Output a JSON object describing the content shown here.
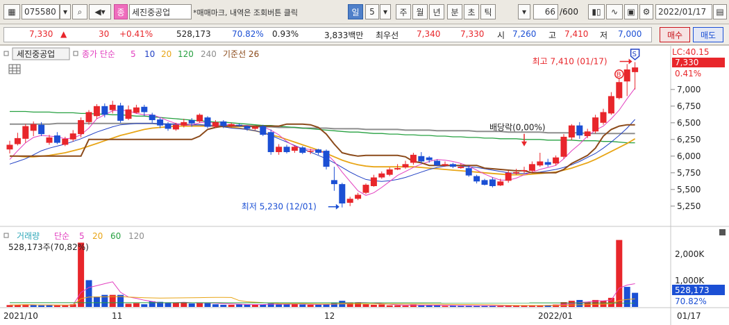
{
  "toolbar": {
    "code": "075580",
    "badge": "종",
    "stock_name": "세진중공업",
    "note": "*매매마크, 내역은 조회버튼 클릭",
    "periods": [
      "일",
      "5",
      "주",
      "월",
      "년",
      "분",
      "초",
      "틱"
    ],
    "count": "66",
    "count_total": "/600",
    "date": "2022/01/17"
  },
  "quote": {
    "price": "7,330",
    "change_arrow": "▲",
    "change": "30",
    "change_pct": "+0.41%",
    "volume": "528,173",
    "vol_ratio": "70.82%",
    "turnover": "0.93%",
    "trade_value": "3,833백만",
    "best_label": "최우선",
    "best_ask": "7,340",
    "best_bid": "7,330",
    "open_label": "시",
    "open": "7,260",
    "high_label": "고",
    "high": "7,410",
    "low_label": "저",
    "low": "7,000",
    "buy_label": "매수",
    "sell_label": "매도"
  },
  "legend": {
    "name": "세진중공업",
    "close_label": "종가 단순",
    "ma": [
      "5",
      "10",
      "20",
      "120",
      "240"
    ],
    "base_label": "기준선 26"
  },
  "volume_legend": {
    "label": "거래량",
    "ma_label": "단순",
    "ma": [
      "5",
      "20",
      "60",
      "120"
    ],
    "value_text": "528,173주(70,82%)"
  },
  "annotations": {
    "high_label": "최고 7,410 (01/17)",
    "low_label": "최저 5,230 (12/01)",
    "dividend_label": "배당락(0,00%)",
    "b_marker": "B",
    "s_marker": "S"
  },
  "right_axis": {
    "lc": "LC:40.15",
    "price_tag": "7,330",
    "pct_tag": "0.41%",
    "vol_tag": "528,173",
    "vol_pct_tag": "70.82%",
    "vol_ticks": [
      "2,000K",
      "1,000K"
    ]
  },
  "colors": {
    "up": "#e8262b",
    "down": "#1b4fd4",
    "ma5": "#e23fbf",
    "ma10": "#2140c4",
    "ma20": "#e8a516",
    "ma120": "#26a040",
    "ma240": "#8d8d8d",
    "base": "#8b4a1a"
  },
  "chart_data": {
    "type": "candlestick",
    "x_labels": [
      "2021/10",
      "11",
      "12",
      "2022/01",
      "01/17"
    ],
    "y_ticks": [
      7000,
      6750,
      6500,
      6250,
      6000,
      5750,
      5500,
      5250
    ],
    "ylim": [
      5050,
      7550
    ],
    "volume_ylim": [
      0,
      2800000
    ],
    "candles": [
      [
        6170,
        6100,
        6230,
        6040
      ],
      [
        6270,
        6180,
        6350,
        6160
      ],
      [
        6450,
        6260,
        6480,
        6200
      ],
      [
        6480,
        6380,
        6520,
        6300
      ],
      [
        6330,
        6470,
        6510,
        6300
      ],
      [
        6280,
        6200,
        6320,
        6170
      ],
      [
        6200,
        6310,
        6360,
        6180
      ],
      [
        6260,
        6170,
        6290,
        6150
      ],
      [
        6340,
        6250,
        6390,
        6220
      ],
      [
        6540,
        6330,
        6580,
        6280
      ],
      [
        6660,
        6510,
        6690,
        6470
      ],
      [
        6750,
        6600,
        6780,
        6560
      ],
      [
        6620,
        6750,
        6790,
        6580
      ],
      [
        6770,
        6690,
        6830,
        6640
      ],
      [
        6530,
        6760,
        6800,
        6500
      ],
      [
        6700,
        6560,
        6760,
        6540
      ],
      [
        6730,
        6650,
        6770,
        6640
      ],
      [
        6660,
        6740,
        6770,
        6600
      ],
      [
        6540,
        6620,
        6650,
        6500
      ],
      [
        6460,
        6550,
        6580,
        6420
      ],
      [
        6410,
        6490,
        6510,
        6380
      ],
      [
        6470,
        6400,
        6500,
        6380
      ],
      [
        6510,
        6460,
        6560,
        6430
      ],
      [
        6490,
        6540,
        6570,
        6440
      ],
      [
        6620,
        6520,
        6640,
        6500
      ],
      [
        6440,
        6580,
        6600,
        6420
      ],
      [
        6510,
        6440,
        6540,
        6420
      ],
      [
        6450,
        6520,
        6540,
        6420
      ],
      [
        6480,
        6450,
        6500,
        6430
      ],
      [
        6460,
        6470,
        6490,
        6440
      ],
      [
        6410,
        6450,
        6460,
        6380
      ],
      [
        6440,
        6410,
        6460,
        6390
      ],
      [
        6320,
        6450,
        6470,
        6300
      ],
      [
        6060,
        6360,
        6400,
        6020
      ],
      [
        6140,
        6060,
        6180,
        6020
      ],
      [
        6060,
        6140,
        6170,
        6040
      ],
      [
        6140,
        6080,
        6160,
        6050
      ],
      [
        6050,
        6130,
        6150,
        6030
      ],
      [
        6080,
        6080,
        6110,
        6030
      ],
      [
        6050,
        6100,
        6110,
        6020
      ],
      [
        5840,
        6080,
        6100,
        5800
      ],
      [
        5580,
        5640,
        5840,
        5480
      ],
      [
        5290,
        5580,
        5600,
        5230
      ],
      [
        5360,
        5300,
        5390,
        5250
      ],
      [
        5420,
        5360,
        5450,
        5340
      ],
      [
        5570,
        5450,
        5590,
        5430
      ],
      [
        5680,
        5550,
        5720,
        5540
      ],
      [
        5740,
        5680,
        5770,
        5660
      ],
      [
        5800,
        5720,
        5830,
        5700
      ],
      [
        5820,
        5800,
        5880,
        5790
      ],
      [
        5880,
        5830,
        5930,
        5810
      ],
      [
        6020,
        5900,
        6050,
        5870
      ],
      [
        5920,
        6000,
        6060,
        5890
      ],
      [
        5940,
        5980,
        6000,
        5900
      ],
      [
        5860,
        5930,
        5950,
        5850
      ],
      [
        5880,
        5860,
        5920,
        5840
      ],
      [
        5840,
        5880,
        5900,
        5820
      ],
      [
        5840,
        5820,
        5890,
        5810
      ],
      [
        5710,
        5820,
        5860,
        5690
      ],
      [
        5620,
        5700,
        5720,
        5590
      ],
      [
        5570,
        5640,
        5660,
        5560
      ],
      [
        5550,
        5650,
        5680,
        5530
      ],
      [
        5620,
        5560,
        5660,
        5550
      ],
      [
        5750,
        5630,
        5780,
        5600
      ],
      [
        5760,
        5740,
        5810,
        5720
      ],
      [
        5790,
        5780,
        5840,
        5740
      ],
      [
        5880,
        5780,
        5920,
        5760
      ],
      [
        5920,
        5860,
        6050,
        5840
      ],
      [
        5870,
        5910,
        5960,
        5840
      ],
      [
        5980,
        5890,
        6010,
        5860
      ],
      [
        6290,
        5990,
        6330,
        5960
      ],
      [
        6460,
        6280,
        6480,
        6240
      ],
      [
        6310,
        6460,
        6510,
        6260
      ],
      [
        6370,
        6300,
        6410,
        6270
      ],
      [
        6580,
        6370,
        6620,
        6340
      ],
      [
        6660,
        6500,
        6710,
        6470
      ],
      [
        6900,
        6640,
        6960,
        6620
      ],
      [
        7110,
        6870,
        7210,
        6850
      ],
      [
        7300,
        7120,
        7380,
        6900
      ],
      [
        7330,
        7260,
        7410,
        7000
      ]
    ],
    "volume": [
      [
        70000,
        1
      ],
      [
        85000,
        1
      ],
      [
        95000,
        1
      ],
      [
        70000,
        0
      ],
      [
        60000,
        0
      ],
      [
        70000,
        0
      ],
      [
        60000,
        1
      ],
      [
        75000,
        1
      ],
      [
        100000,
        1
      ],
      [
        2400000,
        1
      ],
      [
        1000000,
        0
      ],
      [
        390000,
        0
      ],
      [
        450000,
        0
      ],
      [
        450000,
        1
      ],
      [
        450000,
        0
      ],
      [
        120000,
        1
      ],
      [
        140000,
        1
      ],
      [
        100000,
        0
      ],
      [
        210000,
        0
      ],
      [
        190000,
        0
      ],
      [
        150000,
        0
      ],
      [
        160000,
        1
      ],
      [
        160000,
        1
      ],
      [
        130000,
        0
      ],
      [
        150000,
        1
      ],
      [
        160000,
        0
      ],
      [
        100000,
        0
      ],
      [
        80000,
        0
      ],
      [
        80000,
        1
      ],
      [
        100000,
        0
      ],
      [
        100000,
        0
      ],
      [
        80000,
        1
      ],
      [
        90000,
        0
      ],
      [
        130000,
        0
      ],
      [
        100000,
        0
      ],
      [
        100000,
        0
      ],
      [
        120000,
        1
      ],
      [
        90000,
        0
      ],
      [
        80000,
        1
      ],
      [
        80000,
        0
      ],
      [
        110000,
        0
      ],
      [
        150000,
        0
      ],
      [
        230000,
        0
      ],
      [
        170000,
        1
      ],
      [
        170000,
        1
      ],
      [
        100000,
        1
      ],
      [
        80000,
        1
      ],
      [
        90000,
        1
      ],
      [
        60000,
        1
      ],
      [
        60000,
        1
      ],
      [
        50000,
        1
      ],
      [
        90000,
        1
      ],
      [
        60000,
        0
      ],
      [
        60000,
        0
      ],
      [
        60000,
        0
      ],
      [
        40000,
        1
      ],
      [
        50000,
        0
      ],
      [
        40000,
        0
      ],
      [
        50000,
        0
      ],
      [
        40000,
        0
      ],
      [
        50000,
        0
      ],
      [
        50000,
        0
      ],
      [
        45000,
        1
      ],
      [
        60000,
        1
      ],
      [
        50000,
        1
      ],
      [
        50000,
        1
      ],
      [
        60000,
        1
      ],
      [
        50000,
        1
      ],
      [
        70000,
        0
      ],
      [
        90000,
        1
      ],
      [
        180000,
        1
      ],
      [
        230000,
        1
      ],
      [
        260000,
        0
      ],
      [
        180000,
        1
      ],
      [
        260000,
        1
      ],
      [
        230000,
        1
      ],
      [
        340000,
        1
      ],
      [
        2500000,
        1
      ],
      [
        750000,
        0
      ],
      [
        528173,
        0
      ]
    ],
    "ma": {
      "ma5": [
        5950,
        6080,
        6200,
        6280,
        6310,
        6300,
        6290,
        6260,
        6270,
        6320,
        6420,
        6560,
        6620,
        6680,
        6690,
        6680,
        6640,
        6620,
        6620,
        6580,
        6530,
        6490,
        6460,
        6470,
        6500,
        6510,
        6490,
        6480,
        6470,
        6460,
        6460,
        6450,
        6440,
        6390,
        6320,
        6220,
        6150,
        6110,
        6100,
        6080,
        6040,
        5920,
        5760,
        5620,
        5480,
        5410,
        5450,
        5530,
        5620,
        5710,
        5770,
        5830,
        5880,
        5920,
        5950,
        5940,
        5920,
        5890,
        5850,
        5790,
        5730,
        5680,
        5640,
        5640,
        5670,
        5720,
        5760,
        5800,
        5830,
        5860,
        5960,
        6080,
        6180,
        6300,
        6390,
        6450,
        6560,
        6690,
        6860,
        7020
      ],
      "ma10": [
        5880,
        5920,
        5960,
        6020,
        6080,
        6120,
        6150,
        6180,
        6220,
        6260,
        6310,
        6360,
        6400,
        6440,
        6470,
        6480,
        6490,
        6490,
        6490,
        6490,
        6480,
        6480,
        6470,
        6470,
        6470,
        6460,
        6450,
        6440,
        6420,
        6410,
        6400,
        6380,
        6350,
        6310,
        6260,
        6210,
        6160,
        6110,
        6060,
        6010,
        5960,
        5900,
        5830,
        5760,
        5700,
        5650,
        5630,
        5620,
        5630,
        5650,
        5680,
        5720,
        5760,
        5800,
        5830,
        5850,
        5860,
        5850,
        5840,
        5830,
        5810,
        5790,
        5770,
        5750,
        5740,
        5740,
        5750,
        5760,
        5780,
        5800,
        5830,
        5870,
        5920,
        5980,
        6040,
        6120,
        6210,
        6310,
        6420,
        6550
      ],
      "ma20": [
        6000,
        6000,
        5990,
        5990,
        6000,
        6010,
        6030,
        6050,
        6080,
        6110,
        6150,
        6190,
        6230,
        6270,
        6310,
        6340,
        6370,
        6400,
        6420,
        6430,
        6440,
        6450,
        6450,
        6450,
        6450,
        6450,
        6450,
        6440,
        6430,
        6420,
        6400,
        6380,
        6350,
        6320,
        6290,
        6250,
        6210,
        6170,
        6130,
        6090,
        6040,
        5990,
        5940,
        5900,
        5870,
        5850,
        5840,
        5840,
        5840,
        5840,
        5840,
        5840,
        5830,
        5820,
        5810,
        5800,
        5790,
        5780,
        5770,
        5760,
        5750,
        5740,
        5730,
        5720,
        5720,
        5720,
        5730,
        5740,
        5750,
        5760,
        5790,
        5820,
        5860,
        5900,
        5950,
        6010,
        6070,
        6130,
        6190,
        6260
      ],
      "ma120": [
        6670,
        6670,
        6670,
        6660,
        6660,
        6660,
        6650,
        6650,
        6650,
        6640,
        6640,
        6630,
        6630,
        6620,
        6620,
        6610,
        6600,
        6600,
        6590,
        6580,
        6570,
        6560,
        6550,
        6540,
        6530,
        6520,
        6510,
        6510,
        6500,
        6490,
        6480,
        6470,
        6460,
        6460,
        6450,
        6440,
        6430,
        6420,
        6410,
        6400,
        6390,
        6380,
        6370,
        6360,
        6360,
        6350,
        6340,
        6340,
        6330,
        6330,
        6320,
        6320,
        6310,
        6310,
        6300,
        6300,
        6290,
        6290,
        6280,
        6280,
        6270,
        6270,
        6260,
        6260,
        6260,
        6250,
        6250,
        6250,
        6240,
        6240,
        6240,
        6240,
        6230,
        6230,
        6230,
        6220,
        6220,
        6210,
        6200,
        6200
      ],
      "ma240": [
        6480,
        6480,
        6480,
        6480,
        6480,
        6480,
        6490,
        6490,
        6490,
        6490,
        6490,
        6490,
        6490,
        6490,
        6490,
        6490,
        6490,
        6490,
        6490,
        6480,
        6480,
        6480,
        6480,
        6470,
        6470,
        6460,
        6460,
        6460,
        6450,
        6450,
        6450,
        6440,
        6440,
        6440,
        6430,
        6430,
        6430,
        6420,
        6420,
        6420,
        6420,
        6410,
        6410,
        6410,
        6410,
        6400,
        6400,
        6400,
        6400,
        6400,
        6390,
        6390,
        6390,
        6390,
        6380,
        6380,
        6380,
        6380,
        6380,
        6370,
        6370,
        6370,
        6370,
        6360,
        6360,
        6360,
        6360,
        6360,
        6350,
        6350,
        6350,
        6350,
        6350,
        6340,
        6340,
        6340,
        6340,
        6340,
        6340,
        6340
      ],
      "base": [
        6000,
        6000,
        6000,
        6000,
        6000,
        6000,
        6000,
        6000,
        6000,
        6000,
        6250,
        6250,
        6250,
        6250,
        6250,
        6250,
        6250,
        6250,
        6250,
        6250,
        6250,
        6250,
        6250,
        6250,
        6300,
        6400,
        6430,
        6450,
        6450,
        6450,
        6450,
        6450,
        6450,
        6450,
        6450,
        6480,
        6480,
        6480,
        6470,
        6430,
        6330,
        6180,
        6050,
        6020,
        6000,
        6010,
        6010,
        6010,
        6010,
        6010,
        5990,
        5920,
        5900,
        5860,
        5860,
        5860,
        5860,
        5860,
        5860,
        5860,
        5820,
        5810,
        5800,
        5790,
        5780,
        5780,
        5750,
        5750,
        5750,
        5750,
        5800,
        5890,
        5950,
        6010,
        6120,
        6300,
        6400,
        6450,
        6470,
        6470
      ]
    }
  }
}
